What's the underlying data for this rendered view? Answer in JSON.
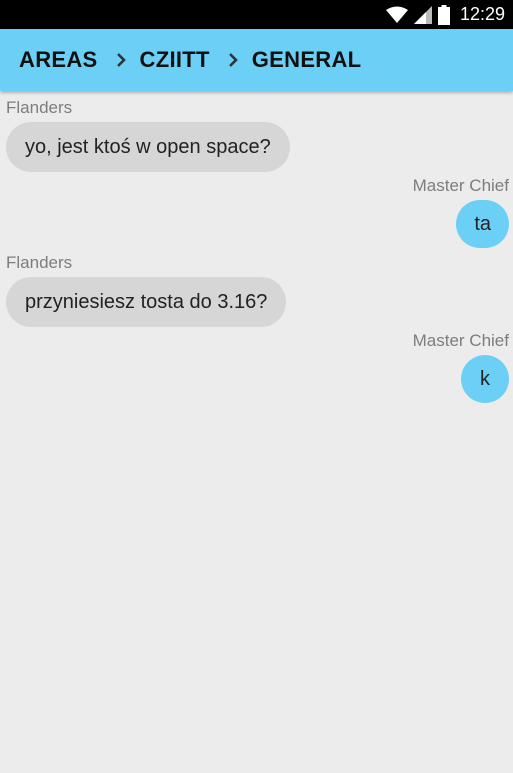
{
  "status_bar": {
    "time": "12:29",
    "icons": [
      "wifi-icon",
      "cell-signal-icon",
      "battery-icon"
    ]
  },
  "breadcrumb": {
    "items": [
      "AREAS",
      "CZIITT",
      "GENERAL"
    ]
  },
  "colors": {
    "accent": "#6ccff6",
    "incoming_bubble": "#d6d6d6",
    "background": "#ececec"
  },
  "messages": [
    {
      "sender": "Flanders",
      "text": "yo, jest ktoś w open space?",
      "direction": "incoming"
    },
    {
      "sender": "Master Chief",
      "text": "ta",
      "direction": "outgoing"
    },
    {
      "sender": "Flanders",
      "text": "przyniesiesz tosta do 3.16?",
      "direction": "incoming"
    },
    {
      "sender": "Master Chief",
      "text": "k",
      "direction": "outgoing"
    }
  ]
}
